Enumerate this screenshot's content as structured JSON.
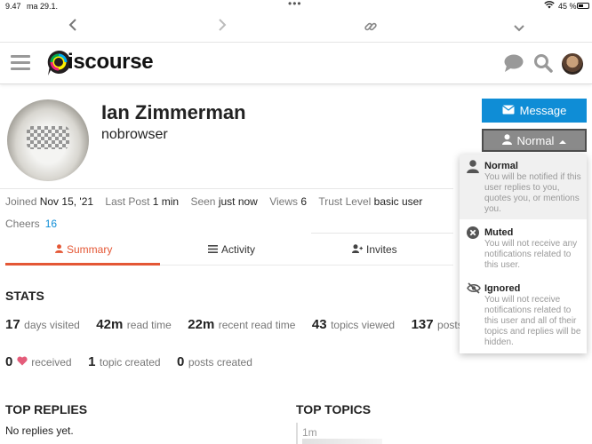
{
  "status_bar": {
    "time": "9.47",
    "date": "ma 29.1.",
    "battery": "45 %"
  },
  "browser": {
    "back_icon": "chevron-left-icon",
    "forward_icon": "chevron-right-icon",
    "link_icon": "link-icon",
    "menu_icon": "chevron-down-icon"
  },
  "header": {
    "logo_text": "Discourse",
    "icons": [
      "hamburger-icon",
      "chat-bubble-icon",
      "search-icon",
      "avatar"
    ]
  },
  "profile": {
    "name": "Ian Zimmerman",
    "username": "nobrowser",
    "message_button": "Message",
    "notification_button": "Normal"
  },
  "details": {
    "joined_label": "Joined",
    "joined_value": "Nov 15, '21",
    "last_post_label": "Last Post",
    "last_post_value": "1 min",
    "seen_label": "Seen",
    "seen_value": "just now",
    "views_label": "Views",
    "views_value": "6",
    "trust_label": "Trust Level",
    "trust_value": "basic user",
    "cheers_label": "Cheers",
    "cheers_value": "16"
  },
  "tabs": {
    "summary": "Summary",
    "activity": "Activity",
    "invites": "Invites"
  },
  "stats": {
    "title": "STATS",
    "days_visited_num": "17",
    "days_visited_lbl": "days visited",
    "read_time_num": "42m",
    "read_time_lbl": "read time",
    "recent_read_num": "22m",
    "recent_read_lbl": "recent read time",
    "topics_viewed_num": "43",
    "topics_viewed_lbl": "topics viewed",
    "posts_read_num": "137",
    "posts_read_lbl": "posts",
    "received_num": "0",
    "received_lbl": "received",
    "topic_created_num": "1",
    "topic_created_lbl": "topic created",
    "posts_created_num": "0",
    "posts_created_lbl": "posts created"
  },
  "sections": {
    "top_replies": "TOP REPLIES",
    "no_replies": "No replies yet.",
    "top_topics": "TOP TOPICS",
    "topic_age": "1m"
  },
  "dropdown": {
    "items": [
      {
        "title": "Normal",
        "desc": "You will be notified if this user replies to you, quotes you, or mentions you.",
        "icon": "user-icon"
      },
      {
        "title": "Muted",
        "desc": "You will not receive any notifications related to this user.",
        "icon": "times-circle-icon"
      },
      {
        "title": "Ignored",
        "desc": "You will not receive notifications related to this user and all of their topics and replies will be hidden.",
        "icon": "eye-slash-icon"
      }
    ]
  },
  "colors": {
    "accent": "#e45735",
    "primary_button": "#0f8dd6",
    "link": "#0f8dd6"
  }
}
